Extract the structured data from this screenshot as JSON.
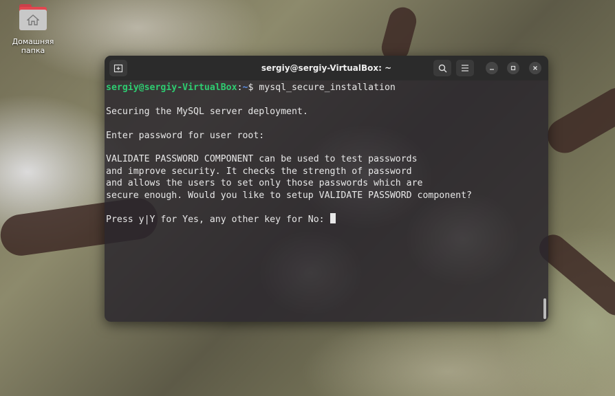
{
  "desktop": {
    "home_folder_label": "Домашняя папка",
    "home_icon": "home-icon"
  },
  "window": {
    "title": "sergiy@sergiy-VirtualBox: ~",
    "new_tab_icon": "new-tab-icon",
    "search_icon": "search-icon",
    "menu_icon": "hamburger-menu-icon",
    "minimize_icon": "minimize-icon",
    "maximize_icon": "maximize-icon",
    "close_icon": "close-icon"
  },
  "terminal": {
    "prompt_user": "sergiy@sergiy-VirtualBox",
    "prompt_sep": ":",
    "prompt_path": "~",
    "prompt_symbol": "$ ",
    "command": "mysql_secure_installation",
    "lines": [
      "",
      "Securing the MySQL server deployment.",
      "",
      "Enter password for user root:",
      "",
      "VALIDATE PASSWORD COMPONENT can be used to test passwords",
      "and improve security. It checks the strength of password",
      "and allows the users to set only those passwords which are",
      "secure enough. Would you like to setup VALIDATE PASSWORD component?",
      ""
    ],
    "last_prompt": "Press y|Y for Yes, any other key for No: "
  },
  "colors": {
    "prompt_user": "#2ecc71",
    "prompt_path": "#5b8ee6",
    "folder": "#e2474f"
  }
}
